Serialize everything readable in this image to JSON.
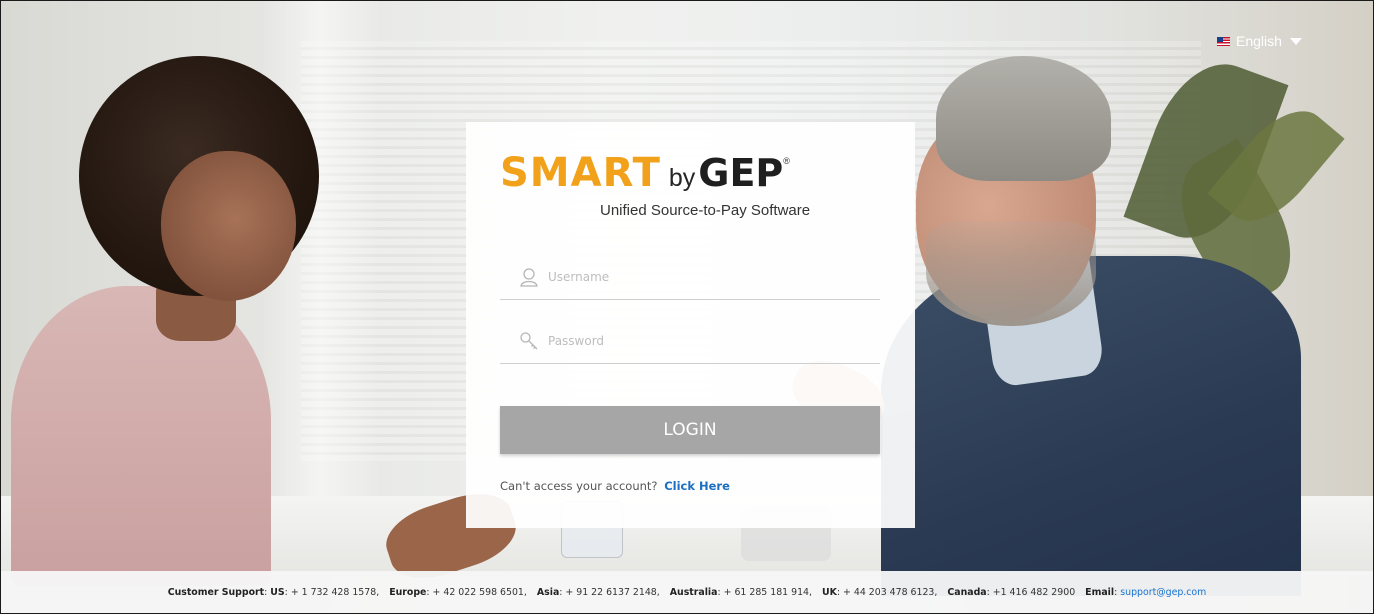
{
  "language": {
    "selected": "English",
    "flag_icon": "us-flag-icon",
    "caret_icon": "caret-down-icon"
  },
  "brand": {
    "logo_smart": "SMART",
    "logo_by": "by",
    "logo_gep": "GEP",
    "logo_reg": "®",
    "tagline": "Unified Source-to-Pay Software",
    "smart_color": "#f2a11a"
  },
  "login": {
    "username_placeholder": "Username",
    "password_placeholder": "Password",
    "login_label": "LOGIN",
    "access_text": "Can't access your account?",
    "access_link": "Click Here",
    "button_color": "#a6a6a6",
    "link_color": "#1b6fc2"
  },
  "footer": {
    "support_label": "Customer Support",
    "contacts": [
      {
        "label": "US",
        "value": "+ 1 732 428 1578,"
      },
      {
        "label": "Europe",
        "value": "+ 42 022 598 6501,"
      },
      {
        "label": "Asia",
        "value": "+ 91 22 6137 2148,"
      },
      {
        "label": "Australia",
        "value": "+ 61 285 181 914,"
      },
      {
        "label": "UK",
        "value": "+ 44 203 478 6123,"
      },
      {
        "label": "Canada",
        "value": "+1 416 482 2900"
      }
    ],
    "email_label": "Email",
    "email": "support@gep.com"
  }
}
